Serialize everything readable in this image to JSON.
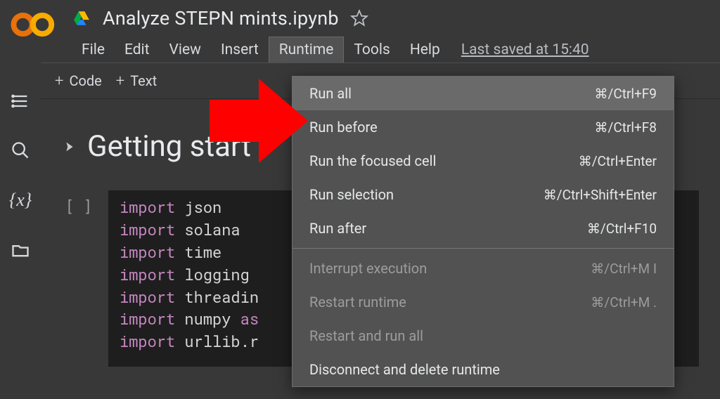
{
  "header": {
    "title": "Analyze STEPN mints.ipynb",
    "menu": {
      "file": "File",
      "edit": "Edit",
      "view": "View",
      "insert": "Insert",
      "runtime": "Runtime",
      "tools": "Tools",
      "help": "Help"
    },
    "last_saved": "Last saved at 15:40"
  },
  "toolbar": {
    "code": "Code",
    "text": "Text"
  },
  "section": {
    "title": "Getting start"
  },
  "code": {
    "l1a": "import",
    "l1b": " json",
    "l2a": "import",
    "l2b": " solana",
    "l3a": "import",
    "l3b": " time",
    "l4a": "import",
    "l4b": " logging",
    "l5a": "import",
    "l5b": " threadin",
    "l6a": "import",
    "l6b": " numpy ",
    "l6c": "as",
    "l7a": "import",
    "l7b": " urllib.r"
  },
  "cell_gutter": "[ ]",
  "runtime_menu": {
    "items": [
      {
        "label": "Run all",
        "shortcut": "⌘/Ctrl+F9",
        "hovered": true
      },
      {
        "label": "Run before",
        "shortcut": "⌘/Ctrl+F8"
      },
      {
        "label": "Run the focused cell",
        "shortcut": "⌘/Ctrl+Enter"
      },
      {
        "label": "Run selection",
        "shortcut": "⌘/Ctrl+Shift+Enter"
      },
      {
        "label": "Run after",
        "shortcut": "⌘/Ctrl+F10"
      }
    ],
    "items2": [
      {
        "label": "Interrupt execution",
        "shortcut": "⌘/Ctrl+M I",
        "disabled": true
      },
      {
        "label": "Restart runtime",
        "shortcut": "⌘/Ctrl+M .",
        "disabled": true
      },
      {
        "label": "Restart and run all",
        "shortcut": "",
        "disabled": true
      },
      {
        "label": "Disconnect and delete runtime",
        "shortcut": ""
      }
    ]
  }
}
